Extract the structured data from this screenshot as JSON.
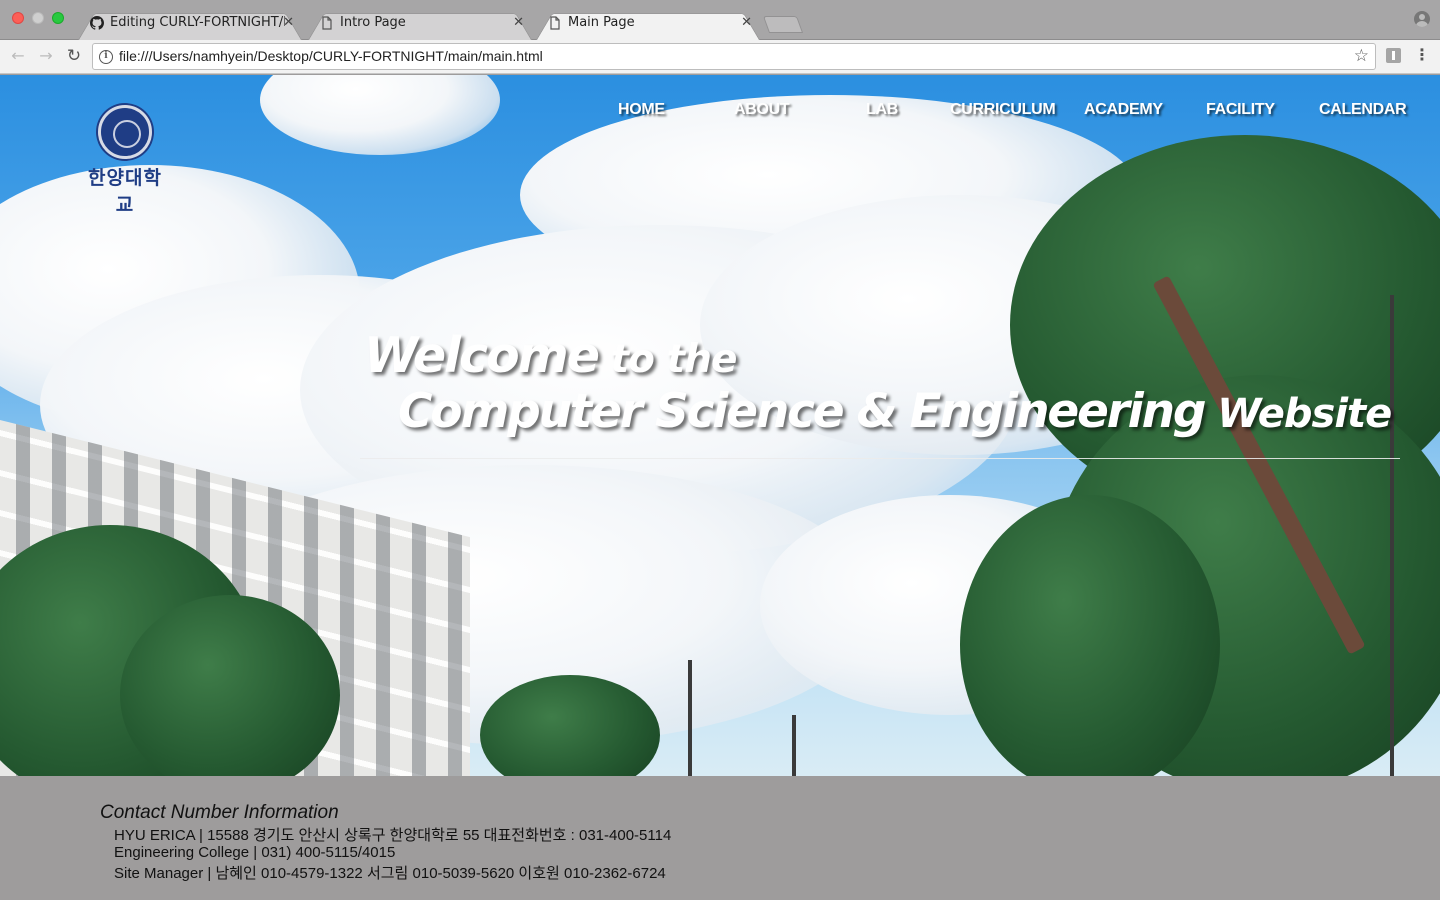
{
  "browser": {
    "tabs": [
      {
        "title": "Editing CURLY-FORTNIGHT/RE",
        "icon": "github-icon",
        "active": false
      },
      {
        "title": "Intro Page",
        "icon": "page-icon",
        "active": false
      },
      {
        "title": "Main Page",
        "icon": "page-icon",
        "active": true
      }
    ],
    "close_glyph": "✕",
    "url": "file:///Users/namhyein/Desktop/CURLY-FORTNIGHT/main/main.html"
  },
  "site": {
    "logo_text": "한양대학교",
    "nav": [
      "HOME",
      "ABOUT",
      "LAB",
      "CURRICULUM",
      "ACADEMY",
      "FACILITY",
      "CALENDAR"
    ],
    "welcome_big": "Welcome",
    "welcome_small": " to the",
    "headline_big": "Computer Science & Engineering",
    "headline_small": " Website"
  },
  "footer": {
    "title": "Contact Number Information",
    "lines": [
      "HYU ERICA | 15588 경기도 안산시 상록구 한양대학로 55 대표전화번호 : 031-400-5114",
      "Engineering College | 031) 400-5115/4015",
      "Site Manager | 남혜인 010-4579-1322 서그림 010-5039-5620 이호원 010-2362-6724"
    ]
  },
  "colors": {
    "footer_bg": "#9e9c9c",
    "logo_blue": "#1f3d85",
    "nav_text": "#ffffff"
  }
}
